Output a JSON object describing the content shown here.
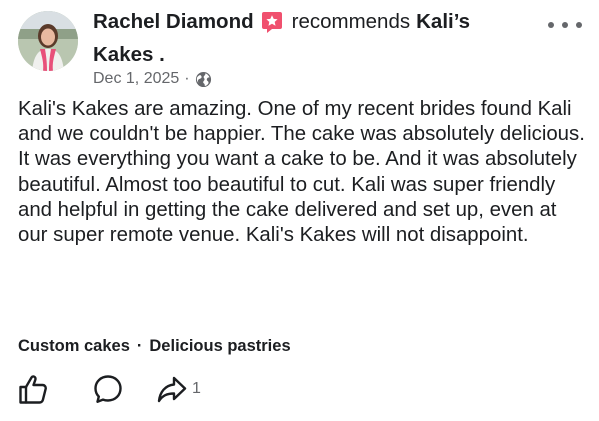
{
  "post": {
    "author": "Rachel Diamond",
    "recommends_text": "recommends",
    "page_name_line1": "Kali’s",
    "page_name_line2": "Kakes .",
    "date": "Dec 1, 2025",
    "meta_separator": "·",
    "audience_icon": "globe-icon",
    "review_text": "Kali's Kakes are amazing. One of my recent brides found Kali and we couldn't be happier. The cake was absolutely delicious. It was everything you want a cake to be. And it was absolutely beautiful. Almost too beautiful to cut. Kali was super friendly and helpful in getting the cake delivered and set up, even at our super remote venue. Kali's Kakes will not disappoint.",
    "tags": [
      "Custom cakes",
      "Delicious pastries"
    ],
    "tag_separator": "·"
  },
  "actions": {
    "like_icon": "thumbs-up-icon",
    "comment_icon": "comment-icon",
    "share_icon": "share-icon",
    "share_count": "1"
  },
  "colors": {
    "text_primary": "#1c1e21",
    "text_secondary": "#65676b",
    "recommend_badge": "#f0506e"
  }
}
